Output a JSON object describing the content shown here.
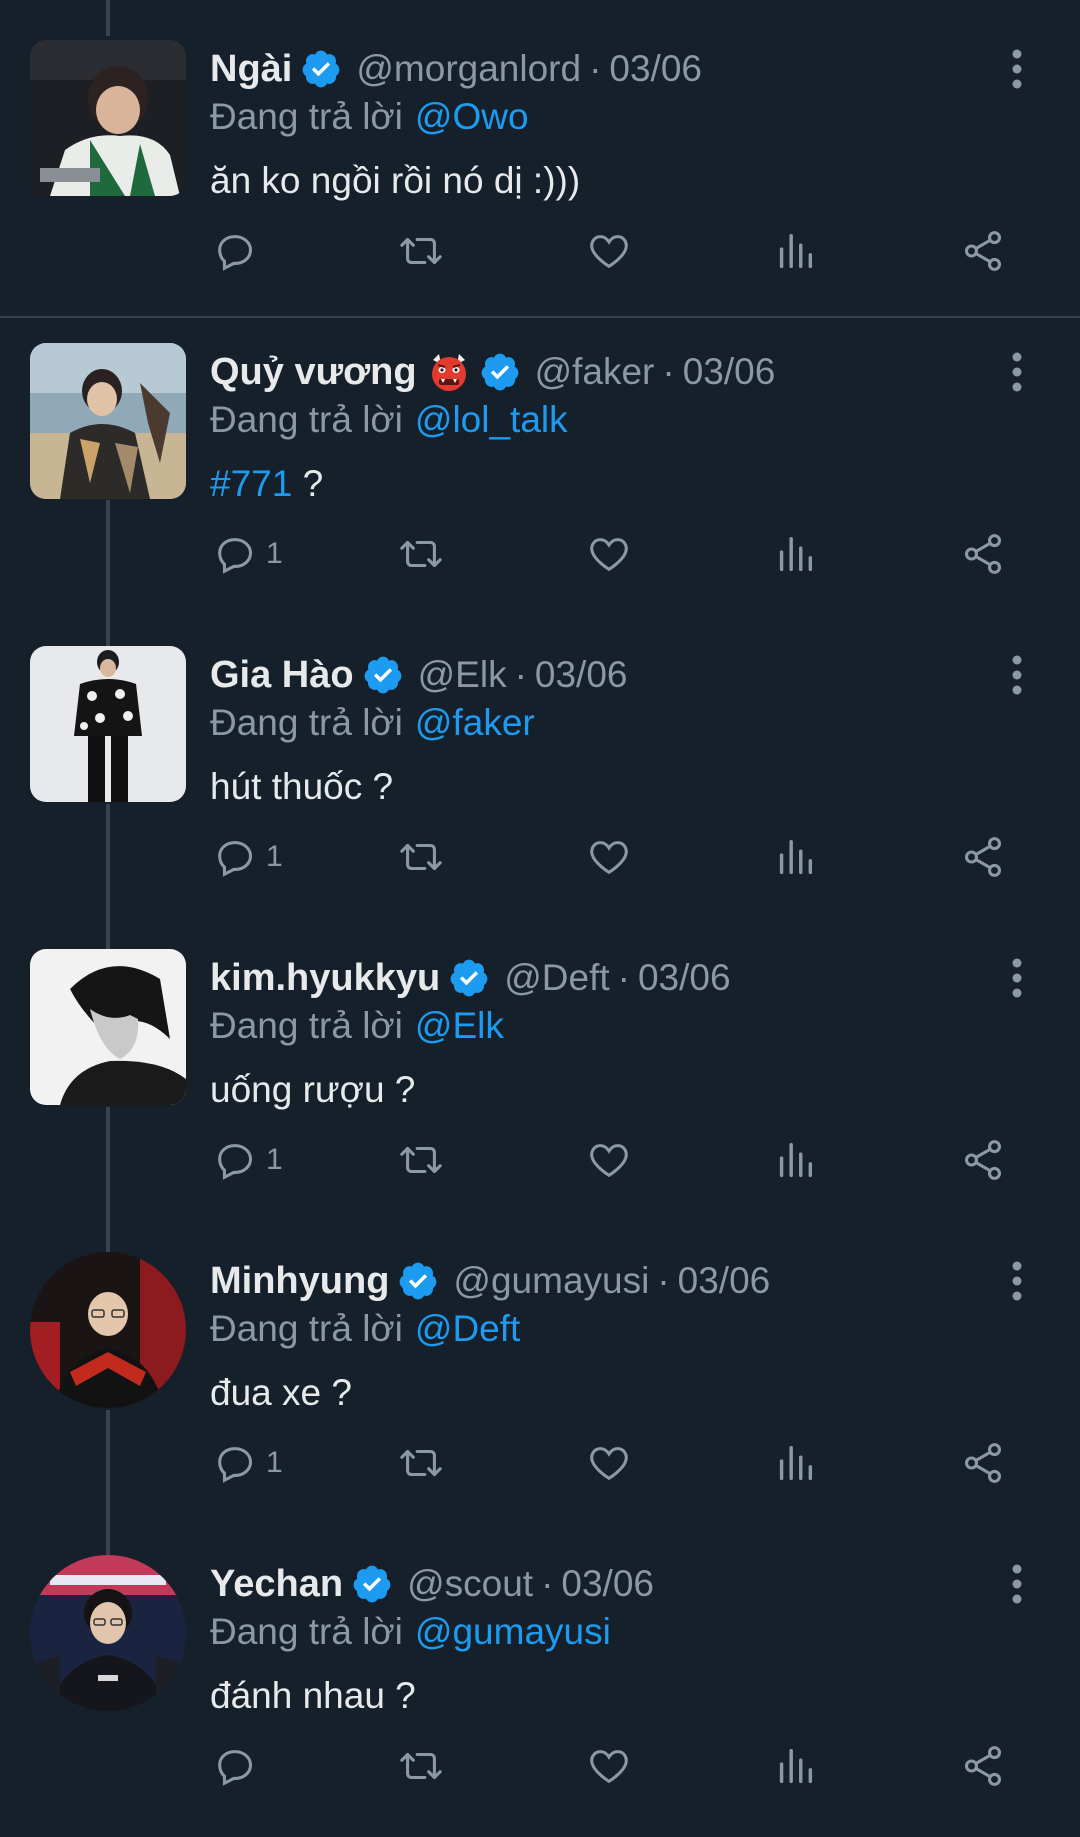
{
  "reply_prefix": "Đang trả lời",
  "colors": {
    "background": "#15202b",
    "accent": "#1d9bf0",
    "muted": "#8b98a5",
    "divider": "#38444d"
  },
  "tweets": [
    {
      "name": "Ngài",
      "handle": "@morganlord",
      "date": "03/06",
      "reply_to": "@Owo",
      "text": "ăn ko ngồi rồi nó dị :)))",
      "hashtag": "",
      "reply_count": "",
      "has_emoji": false,
      "avatar_icon": "player-avatar"
    },
    {
      "name": "Quỷ vương",
      "handle": "@faker",
      "date": "03/06",
      "reply_to": "@lol_talk",
      "hashtag": "#771",
      "text": " ?",
      "reply_count": "1",
      "has_emoji": true,
      "avatar_icon": "portrait-avatar"
    },
    {
      "name": "Gia Hào",
      "handle": "@Elk",
      "date": "03/06",
      "reply_to": "@faker",
      "text": "hút thuốc ?",
      "hashtag": "",
      "reply_count": "1",
      "has_emoji": false,
      "avatar_icon": "fullbody-avatar"
    },
    {
      "name": "kim.hyukkyu",
      "handle": "@Deft",
      "date": "03/06",
      "reply_to": "@Elk",
      "text": "uống rượu ?",
      "hashtag": "",
      "reply_count": "1",
      "has_emoji": false,
      "avatar_icon": "bw-portrait-avatar"
    },
    {
      "name": "Minhyung",
      "handle": "@gumayusi",
      "date": "03/06",
      "reply_to": "@Deft",
      "text": "đua xe ?",
      "hashtag": "",
      "reply_count": "1",
      "has_emoji": false,
      "avatar_icon": "round-portrait-avatar"
    },
    {
      "name": "Yechan",
      "handle": "@scout",
      "date": "03/06",
      "reply_to": "@gumayusi",
      "text": "đánh nhau ?",
      "hashtag": "",
      "reply_count": "",
      "has_emoji": false,
      "avatar_icon": "round-portrait-avatar"
    }
  ]
}
